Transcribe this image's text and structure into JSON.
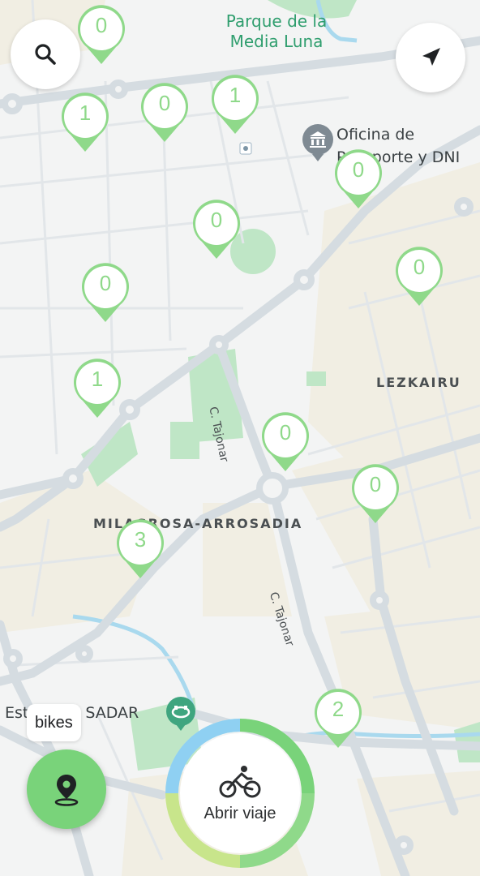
{
  "map": {
    "park_label": "Parque de la Media Luna",
    "poi_office_label": "Oficina de Pasaporte y DNI",
    "district_lezkairu": "LEZKAIRU",
    "district_milagrosa": "MILAGROSA-ARROSADIA",
    "street_tajonar_1": "C. Tajonar",
    "street_tajonar_2": "C. Tajonar",
    "stadium_label": "Estadio El SADAR"
  },
  "stations": [
    {
      "count": "0"
    },
    {
      "count": "1"
    },
    {
      "count": "0"
    },
    {
      "count": "1"
    },
    {
      "count": "0"
    },
    {
      "count": "0"
    },
    {
      "count": "0"
    },
    {
      "count": "0"
    },
    {
      "count": "1"
    },
    {
      "count": "0"
    },
    {
      "count": "0"
    },
    {
      "count": "3"
    },
    {
      "count": "2"
    }
  ],
  "controls": {
    "search_icon": "search-icon",
    "navigate_icon": "navigation-arrow-icon",
    "bikes_label": "bikes",
    "locate_icon": "location-pin-icon",
    "trip_label": "Abrir viaje",
    "trip_icon": "bicycle-rider-icon"
  },
  "colors": {
    "accent_green": "#79d37a",
    "marker_stroke": "#8fd98a",
    "park_green": "#a8dfb4",
    "road": "#d7dee3",
    "trip_ring_blue": "#8fd0f2",
    "trip_ring_green": "#7ccf6f"
  }
}
